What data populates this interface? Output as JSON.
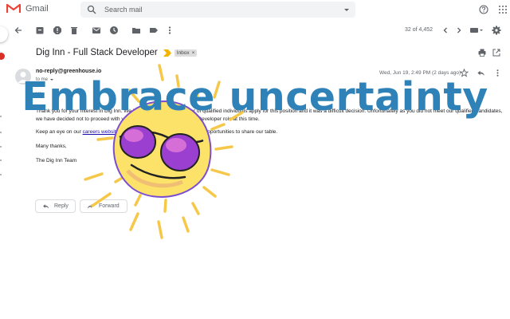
{
  "app": {
    "name": "Gmail"
  },
  "search": {
    "placeholder": "Search mail"
  },
  "toolbar": {
    "page_count": "32 of 4,452"
  },
  "email": {
    "subject": "Dig Inn - Full Stack Developer",
    "label": "Inbox",
    "sender": "no-reply@greenhouse.io",
    "to": "to me",
    "date": "Wed, Jun 19, 2:49 PM (2 days ago)",
    "greeting": "Hi",
    "para1": "Thank you for your interest in Dig Inn. We had an exceptional number of qualified individuals apply for this position and it was a difficult decision. Unfortunately as you did not meet our qualified candidates, we have decided not to proceed with your candidacy for the Full Stack Developer role at this time.",
    "para2_before": "Keep an eye on our",
    "para2_link": "careers website",
    "para2_after": "and our social media page for future opportunities to share our table.",
    "thanks": "Many thanks,",
    "signoff": "The Dig Inn Team"
  },
  "actions": {
    "reply": "Reply",
    "forward": "Forward"
  },
  "overlay": {
    "headline": "Embrace uncertainty"
  },
  "colors": {
    "gmail_red": "#EA4335",
    "headline_blue": "#2e82b7",
    "sun_yellow": "#f6c84a",
    "glasses_purple": "#9a3fd0",
    "important_yellow": "#f4b400"
  }
}
